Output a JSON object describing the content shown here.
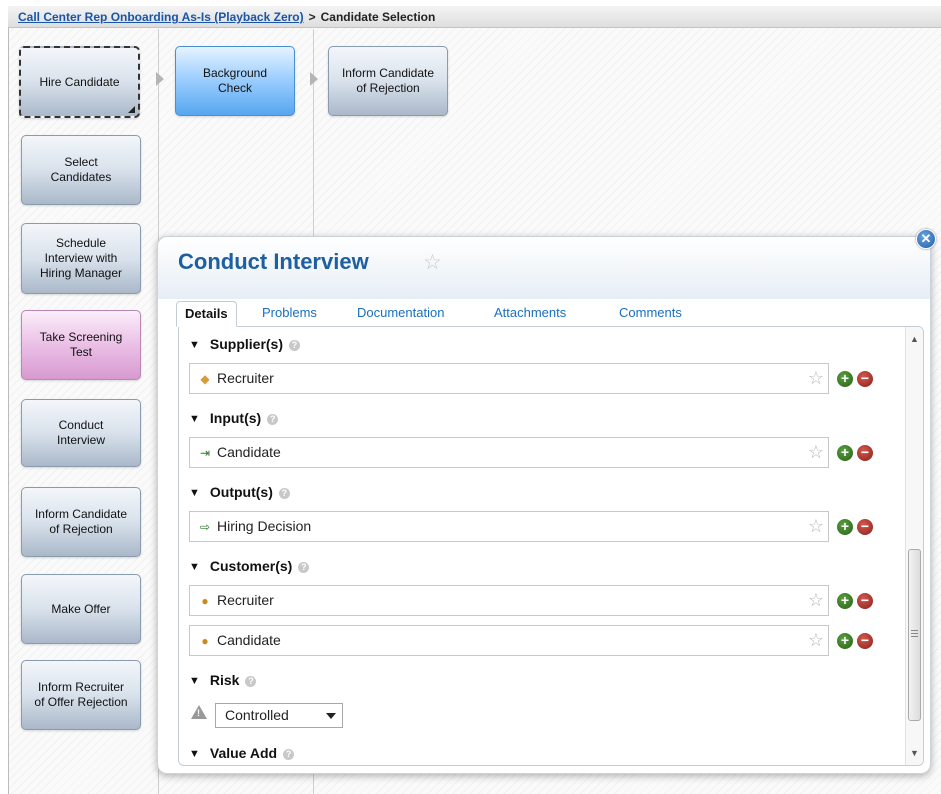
{
  "breadcrumb": {
    "parent": "Call Center Rep Onboarding As-Is (Playback Zero)",
    "separator": ">",
    "current": "Candidate Selection"
  },
  "top_flow": [
    {
      "label": "Hire Candidate"
    },
    {
      "label": "Background\nCheck"
    },
    {
      "label": "Inform Candidate\nof Rejection"
    }
  ],
  "side_nodes": [
    {
      "label": "Select\nCandidates"
    },
    {
      "label": "Schedule\nInterview with\nHiring Manager"
    },
    {
      "label": "Take Screening\nTest"
    },
    {
      "label": "Conduct\nInterview"
    },
    {
      "label": "Inform Candidate\nof Rejection"
    },
    {
      "label": "Make Offer"
    },
    {
      "label": "Inform Recruiter\nof Offer Rejection"
    }
  ],
  "panel": {
    "title": "Conduct Interview",
    "tabs": [
      "Details",
      "Problems",
      "Documentation",
      "Attachments",
      "Comments"
    ],
    "active_tab": "Details",
    "sections": {
      "suppliers": {
        "label": "Supplier(s)",
        "items": [
          "Recruiter"
        ]
      },
      "inputs": {
        "label": "Input(s)",
        "items": [
          "Candidate"
        ]
      },
      "outputs": {
        "label": "Output(s)",
        "items": [
          "Hiring Decision"
        ]
      },
      "customers": {
        "label": "Customer(s)",
        "items": [
          "Recruiter",
          "Candidate"
        ]
      },
      "risk": {
        "label": "Risk",
        "value": "Controlled"
      },
      "value_add": {
        "label": "Value Add"
      }
    }
  },
  "colors": {
    "link": "#1a55a6",
    "title": "#1d5fa0",
    "selected_border": "#a6cd54",
    "blue_node": "#55a6f0",
    "pink_node": "#d79acf"
  }
}
